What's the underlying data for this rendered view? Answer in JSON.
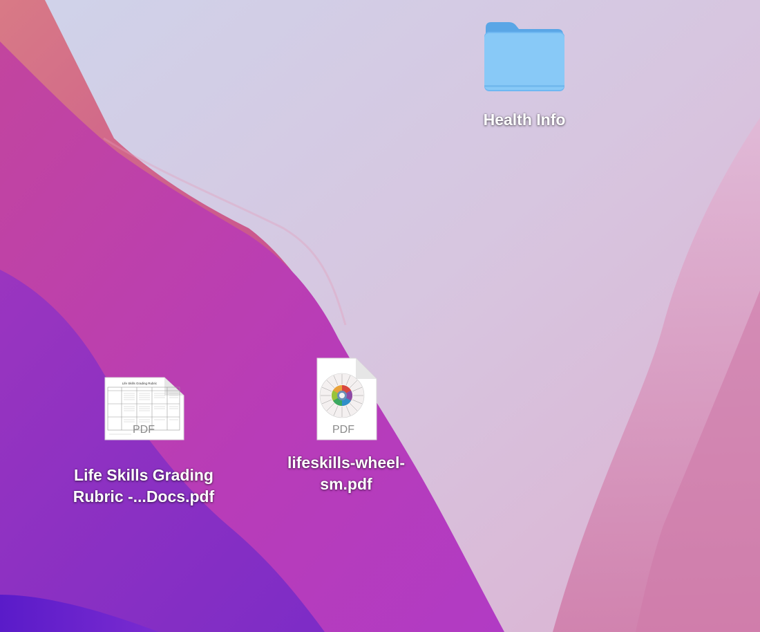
{
  "desktop": {
    "items": [
      {
        "type": "folder",
        "name": "Health Info",
        "icon": "folder-icon",
        "color": "#84c6f5"
      },
      {
        "type": "pdf",
        "name_lines": [
          "Life Skills Grading",
          "Rubric -...Docs.pdf"
        ],
        "icon": "pdf-document-icon",
        "badge": "PDF",
        "thumbnail_title": "Life Skills Grading Rubric"
      },
      {
        "type": "pdf",
        "name_lines": [
          "lifeskills-wheel-",
          "sm.pdf"
        ],
        "icon": "pdf-document-icon",
        "badge": "PDF"
      }
    ]
  },
  "colors": {
    "wallpaper_light": "#d6cde4",
    "wallpaper_pink": "#d98bb6",
    "wallpaper_magenta": "#b33fb8",
    "wallpaper_purple": "#7a2cc4"
  }
}
